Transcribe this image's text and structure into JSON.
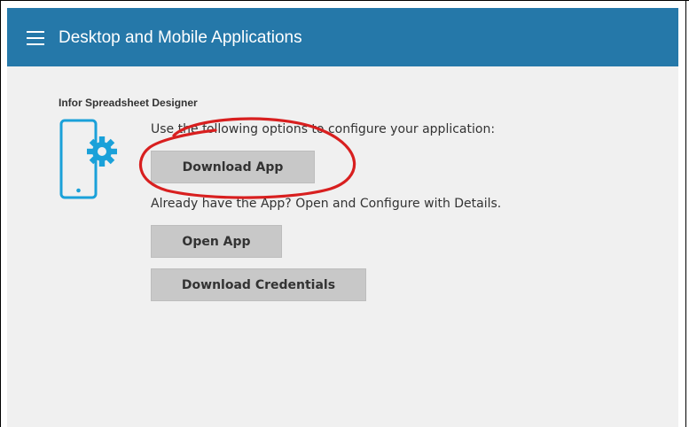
{
  "header": {
    "title": "Desktop and Mobile Applications",
    "menu_icon": "hamburger-menu-icon",
    "background_color": "#2578a9"
  },
  "main": {
    "section_title": "Infor Spreadsheet Designer",
    "device_icon": "mobile-settings-icon",
    "icon_color": "#1aa1d9",
    "intro_text": "Use the following options to configure your application:",
    "download_app_label": "Download App",
    "already_have_text": "Already have the App? Open and Configure with Details.",
    "open_app_label": "Open App",
    "download_credentials_label": "Download Credentials"
  },
  "annotation": {
    "type": "red-circle-highlight",
    "color": "#d81f1f",
    "target": "Download App"
  }
}
